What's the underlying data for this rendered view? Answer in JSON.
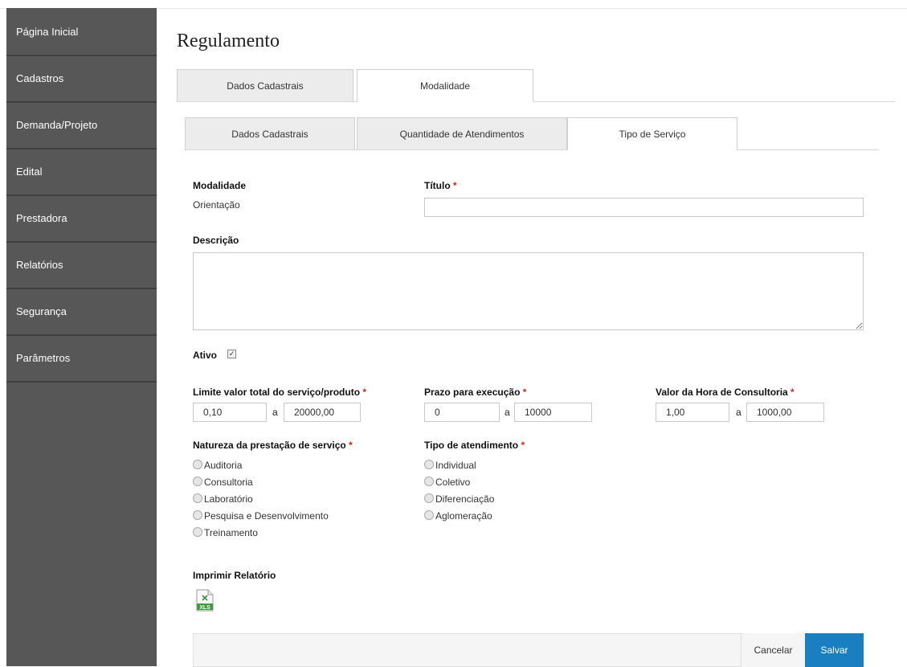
{
  "sidebar": {
    "items": [
      {
        "label": "Página Inicial"
      },
      {
        "label": "Cadastros"
      },
      {
        "label": "Demanda/Projeto"
      },
      {
        "label": "Edital"
      },
      {
        "label": "Prestadora"
      },
      {
        "label": "Relatórios"
      },
      {
        "label": "Segurança"
      },
      {
        "label": "Parâmetros"
      }
    ]
  },
  "page": {
    "title": "Regulamento"
  },
  "tabs_main": [
    {
      "label": "Dados Cadastrais",
      "active": false
    },
    {
      "label": "Modalidade",
      "active": true
    }
  ],
  "tabs_sub": [
    {
      "label": "Dados Cadastrais",
      "active": false
    },
    {
      "label": "Quantidade de Atendimentos",
      "active": false
    },
    {
      "label": "Tipo de Serviço",
      "active": true
    }
  ],
  "form": {
    "modalidade_label": "Modalidade",
    "modalidade_value": "Orientação",
    "titulo_label": "Título",
    "titulo_value": "",
    "descricao_label": "Descrição",
    "descricao_value": "",
    "ativo_label": "Ativo",
    "ativo_checked": true,
    "required_mark": "*",
    "between_label": "a",
    "limite": {
      "label": "Limite valor total do serviço/produto",
      "from": "0,10",
      "to": "20000,00"
    },
    "prazo": {
      "label": "Prazo para execução",
      "from": "0",
      "to": "10000"
    },
    "valor_hora": {
      "label": "Valor da Hora de Consultoria",
      "from": "1,00",
      "to": "1000,00"
    },
    "natureza": {
      "label": "Natureza da prestação de serviço",
      "options": [
        "Auditoria",
        "Consultoria",
        "Laboratório",
        "Pesquisa e Desenvolvimento",
        "Treinamento"
      ]
    },
    "tipo_atendimento": {
      "label": "Tipo de atendimento",
      "options": [
        "Individual",
        "Coletivo",
        "Diferenciação",
        "Aglomeração"
      ]
    },
    "imprimir_label": "Imprimir Relatório",
    "xls_icon_text": "XLS"
  },
  "footer": {
    "cancel_label": "Cancelar",
    "save_label": "Salvar"
  },
  "colors": {
    "sidebar": "#575757",
    "primary": "#1a7fc1",
    "required": "#d9241c"
  }
}
